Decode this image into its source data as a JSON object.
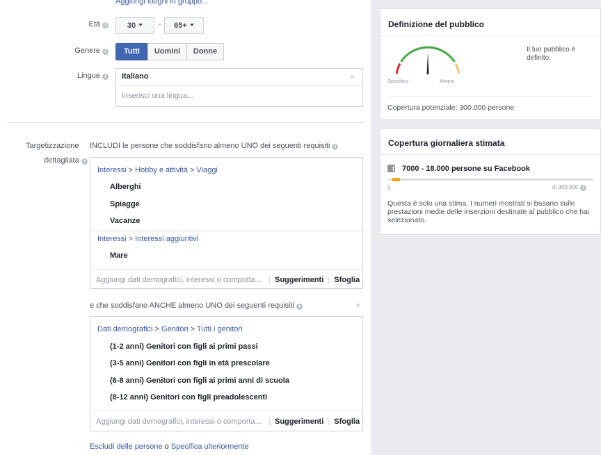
{
  "top": {
    "add_places_link": "Aggiungi luoghi in gruppo..."
  },
  "age": {
    "label": "Età",
    "min": "30",
    "dash": "-",
    "max": "65+"
  },
  "gender": {
    "label": "Genere",
    "options": [
      "Tutti",
      "Uomini",
      "Donne"
    ],
    "selected": "Tutti"
  },
  "languages": {
    "label": "Lingue",
    "selected": "Italiano",
    "placeholder": "Inserisci una lingua..."
  },
  "detailed": {
    "label_line1": "Targetizzazione",
    "label_line2": "dettagliata",
    "include_text": "INCLUDI le persone che soddisfano almeno UNO dei seguenti requisiti",
    "group1": {
      "path1": [
        "Interessi",
        "Hobby e attività",
        "Viaggi"
      ],
      "items1": [
        "Alberghi",
        "Spiagge",
        "Vacanze"
      ],
      "path2": [
        "Interessi",
        "Interessi aggiuntivi"
      ],
      "items2": [
        "Mare"
      ],
      "placeholder": "Aggiungi dati demografici, interessi o comporta...",
      "suggestions": "Suggerimenti",
      "browse": "Sfoglia"
    },
    "and_text": "e che soddisfano ANCHE almeno UNO dei seguenti requisiti",
    "group2": {
      "path": [
        "Dati demografici",
        "Genitori",
        "Tutti i genitori"
      ],
      "items": [
        "(1-2 anni) Genitori con figli ai primi passi",
        "(3-5 anni) Genitori con figli in età prescolare",
        "(6-8 anni) Genitori con figli ai primi anni di scuola",
        "(8-12 anni) Genitori con figli preadolescenti"
      ],
      "placeholder": "Aggiungi dati demografici, interessi o comporta...",
      "suggestions": "Suggerimenti",
      "browse": "Sfoglia"
    },
    "exclude_link": "Escludi delle persone",
    "or_text": "o",
    "narrow_link": "Specifica ulteriormente"
  },
  "audience_definition": {
    "title": "Definizione del pubblico",
    "gauge_specific": "Specifico",
    "gauge_broad": "Ampio",
    "status": "Il tuo pubblico è definito.",
    "potential_reach": "Copertura potenziale: 300.000 persone",
    "colors": {
      "red": "#e02a2a",
      "green": "#42a744",
      "yellow": "#f7c57a"
    }
  },
  "daily_reach": {
    "title": "Copertura giornaliera stimata",
    "range": "7000 - 18.000 persone su Facebook",
    "bar_min": "0",
    "bar_max": "di 300.000",
    "bar_start_fraction": 0.023,
    "bar_end_fraction": 0.06,
    "bar_color": "#f7a21b",
    "note": "Questa è solo una stima. I numeri mostrati si basano sulle prestazioni medie delle inserzioni destinate al pubblico che hai selezionato."
  }
}
